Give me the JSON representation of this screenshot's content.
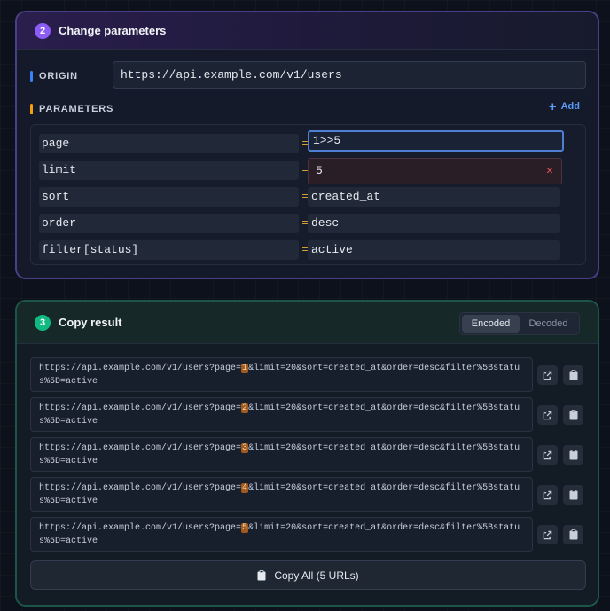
{
  "params_card": {
    "step": "2",
    "title": "Change parameters",
    "origin_label": "ORIGIN",
    "origin_value": "https://api.example.com/v1/users",
    "parameters_label": "PARAMETERS",
    "add_label": "Add",
    "params": [
      {
        "key": "page",
        "value": "1>>5"
      },
      {
        "key": "limit",
        "value": "5"
      },
      {
        "key": "sort",
        "value": "created_at"
      },
      {
        "key": "order",
        "value": "desc"
      },
      {
        "key": "filter[status]",
        "value": "active"
      }
    ],
    "equals": "="
  },
  "result_card": {
    "step": "3",
    "title": "Copy result",
    "tabs": [
      {
        "label": "Encoded",
        "active": true
      },
      {
        "label": "Decoded",
        "active": false
      }
    ],
    "urls": [
      {
        "before": "https://api.example.com/v1/users?page=",
        "page": "1",
        "after": "&limit=20&sort=created_at&order=desc&filter%5Bstatus%5D=active"
      },
      {
        "before": "https://api.example.com/v1/users?page=",
        "page": "2",
        "after": "&limit=20&sort=created_at&order=desc&filter%5Bstatus%5D=active"
      },
      {
        "before": "https://api.example.com/v1/users?page=",
        "page": "3",
        "after": "&limit=20&sort=created_at&order=desc&filter%5Bstatus%5D=active"
      },
      {
        "before": "https://api.example.com/v1/users?page=",
        "page": "4",
        "after": "&limit=20&sort=created_at&order=desc&filter%5Bstatus%5D=active"
      },
      {
        "before": "https://api.example.com/v1/users?page=",
        "page": "5",
        "after": "&limit=20&sort=created_at&order=desc&filter%5Bstatus%5D=active"
      }
    ],
    "copy_all_label": "Copy All (5 URLs)"
  },
  "icons": {
    "open": "external-link-icon",
    "copy": "clipboard-icon",
    "clear": "close-icon",
    "add": "plus-icon"
  },
  "colors": {
    "accent_purple": "#8b5cf6",
    "accent_green": "#10b981",
    "accent_blue": "#3b82f6",
    "accent_orange": "#f59e0b",
    "error_red": "#e05555",
    "page_highlight": "#a05a20"
  }
}
